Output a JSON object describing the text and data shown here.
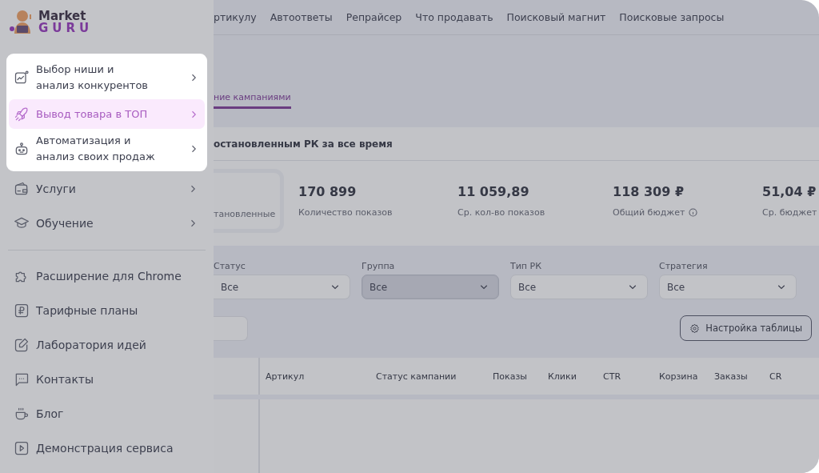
{
  "logo": {
    "line_1": "Market",
    "line_2": "GURU"
  },
  "sidebar": {
    "menu_card": [
      {
        "label": "Выбор ниши и\nанализ конкурентов",
        "selected": false
      },
      {
        "label": "Вывод товара в ТОП",
        "selected": true
      },
      {
        "label": "Автоматизация и\nанализ своих продаж",
        "selected": false
      }
    ],
    "items": [
      {
        "kind": "item",
        "label": "Услуги",
        "submenu": true
      },
      {
        "kind": "item",
        "label": "Обучение",
        "submenu": true
      },
      {
        "kind": "divider"
      },
      {
        "kind": "item",
        "label": "Расширение для Chrome",
        "submenu": false
      },
      {
        "kind": "item",
        "label": "Тарифные планы",
        "submenu": false
      },
      {
        "kind": "item",
        "label": "Лаборатория идей",
        "submenu": false
      },
      {
        "kind": "item",
        "label": "Контакты",
        "submenu": false
      },
      {
        "kind": "item",
        "label": "Блог",
        "submenu": false
      },
      {
        "kind": "item",
        "label": "Демонстрация сервиса",
        "submenu": false
      }
    ]
  },
  "top_nav": [
    "ртикулу",
    "Автоответы",
    "Репрайсер",
    "Что продавать",
    "Поисковый магнит",
    "Поисковые запросы"
  ],
  "tab": {
    "label": "ние кампаниями",
    "selected": true
  },
  "stats_card": {
    "title": "остановленным РК за все время",
    "first_box_label": "тановленные",
    "stats": [
      {
        "value": "170 899",
        "label": "Количество показов",
        "info": false
      },
      {
        "value": "11 059,89",
        "label": "Ср. кол-во показов",
        "info": false
      },
      {
        "value": "118 309 ₽",
        "label": "Общий бюджет",
        "info": true
      },
      {
        "value": "51,04 ₽",
        "label": "Ср. бюджет",
        "info": false
      }
    ]
  },
  "filters": [
    {
      "label": "Статус",
      "value": "Все",
      "selected": false
    },
    {
      "label": "Группа",
      "value": "Все",
      "selected": true
    },
    {
      "label": "Тип РК",
      "value": "Все",
      "selected": false
    },
    {
      "label": "Стратегия",
      "value": "Все",
      "selected": false
    }
  ],
  "table_settings_button": "Настройка таблицы",
  "table": {
    "columns": [
      "Артикул",
      "Статус кампании",
      "Показы",
      "Клики",
      "CTR",
      "Корзина",
      "Заказы",
      "CR"
    ]
  }
}
